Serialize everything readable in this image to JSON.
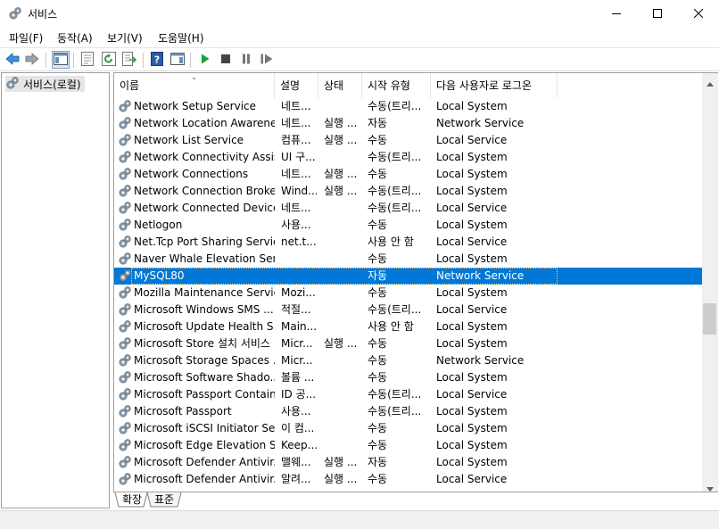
{
  "window": {
    "title": "서비스",
    "minimize_icon": "minimize-icon",
    "maximize_icon": "maximize-icon",
    "close_icon": "close-icon"
  },
  "menu": [
    {
      "label": "파일",
      "key": "(F)"
    },
    {
      "label": "동작",
      "key": "(A)"
    },
    {
      "label": "보기",
      "key": "(V)"
    },
    {
      "label": "도움말",
      "key": "(H)"
    }
  ],
  "toolbar": [
    "back-icon",
    "forward-icon",
    "show-hide-console-tree-icon",
    "properties-icon",
    "refresh-icon",
    "export-list-icon",
    "help-icon",
    "show-action-pane-icon",
    "start-service-icon",
    "stop-service-icon",
    "pause-service-icon",
    "restart-service-icon"
  ],
  "tree": {
    "label": "서비스(로컬)"
  },
  "columns": {
    "name": "이름",
    "desc": "설명",
    "status": "상태",
    "startup": "시작 유형",
    "logon": "다음 사용자로 로그온"
  },
  "services": [
    {
      "name": "Network Setup Service",
      "desc": "네트...",
      "status": "",
      "startup": "수동(트리...",
      "logon": "Local System"
    },
    {
      "name": "Network Location Awareness",
      "desc": "네트...",
      "status": "실행 ...",
      "startup": "자동",
      "logon": "Network Service"
    },
    {
      "name": "Network List Service",
      "desc": "컴퓨...",
      "status": "실행 ...",
      "startup": "수동",
      "logon": "Local Service"
    },
    {
      "name": "Network Connectivity Assis...",
      "desc": "UI 구...",
      "status": "",
      "startup": "수동(트리...",
      "logon": "Local System"
    },
    {
      "name": "Network Connections",
      "desc": "네트...",
      "status": "실행 ...",
      "startup": "수동",
      "logon": "Local System"
    },
    {
      "name": "Network Connection Broker",
      "desc": "Wind...",
      "status": "실행 ...",
      "startup": "수동(트리...",
      "logon": "Local System"
    },
    {
      "name": "Network Connected Device...",
      "desc": "네트...",
      "status": "",
      "startup": "수동(트리...",
      "logon": "Local Service"
    },
    {
      "name": "Netlogon",
      "desc": "사용...",
      "status": "",
      "startup": "수동",
      "logon": "Local System"
    },
    {
      "name": "Net.Tcp Port Sharing Service",
      "desc": "net.t...",
      "status": "",
      "startup": "사용 안 함",
      "logon": "Local Service"
    },
    {
      "name": "Naver Whale Elevation Serv...",
      "desc": "",
      "status": "",
      "startup": "수동",
      "logon": "Local System"
    },
    {
      "name": "MySQL80",
      "desc": "",
      "status": "",
      "startup": "자동",
      "logon": "Network Service",
      "selected": true
    },
    {
      "name": "Mozilla Maintenance Service",
      "desc": "Mozi...",
      "status": "",
      "startup": "수동",
      "logon": "Local System"
    },
    {
      "name": "Microsoft Windows SMS ...",
      "desc": "적절...",
      "status": "",
      "startup": "수동(트리...",
      "logon": "Local Service"
    },
    {
      "name": "Microsoft Update Health S...",
      "desc": "Main...",
      "status": "",
      "startup": "사용 안 함",
      "logon": "Local System"
    },
    {
      "name": "Microsoft Store 설치 서비스",
      "desc": "Micr...",
      "status": "실행 ...",
      "startup": "수동",
      "logon": "Local System"
    },
    {
      "name": "Microsoft Storage Spaces ...",
      "desc": "Micr...",
      "status": "",
      "startup": "수동",
      "logon": "Network Service"
    },
    {
      "name": "Microsoft Software Shado...",
      "desc": "볼륨 ...",
      "status": "",
      "startup": "수동",
      "logon": "Local System"
    },
    {
      "name": "Microsoft Passport Container",
      "desc": "ID 공...",
      "status": "",
      "startup": "수동(트리...",
      "logon": "Local Service"
    },
    {
      "name": "Microsoft Passport",
      "desc": "사용...",
      "status": "",
      "startup": "수동(트리...",
      "logon": "Local System"
    },
    {
      "name": "Microsoft iSCSI Initiator Se...",
      "desc": "이 컴...",
      "status": "",
      "startup": "수동",
      "logon": "Local System"
    },
    {
      "name": "Microsoft Edge Elevation S...",
      "desc": "Keep...",
      "status": "",
      "startup": "수동",
      "logon": "Local System"
    },
    {
      "name": "Microsoft Defender Antivir...",
      "desc": "맬웨...",
      "status": "실행 ...",
      "startup": "자동",
      "logon": "Local System"
    },
    {
      "name": "Microsoft Defender Antivir...",
      "desc": "알려...",
      "status": "실행 ...",
      "startup": "수동",
      "logon": "Local Service"
    }
  ],
  "tabs": [
    "확장",
    "표준"
  ],
  "colors": {
    "selection": "#0078d7",
    "text": "#000000",
    "border": "#a0a0a0"
  }
}
